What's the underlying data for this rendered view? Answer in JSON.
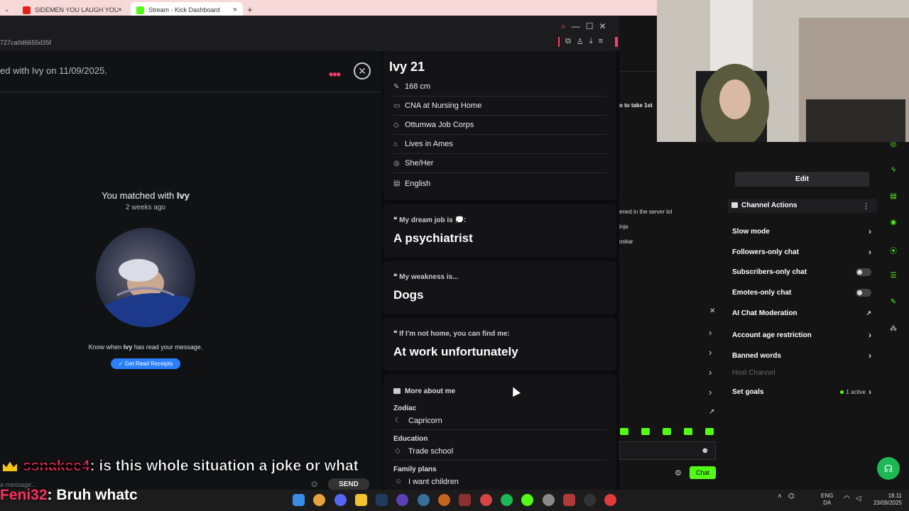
{
  "browser": {
    "tabs": [
      {
        "label": "SIDEMEN YOU LAUGH YOU LOSE",
        "favicon_color": "#e62117"
      },
      {
        "label": "Stream - Kick Dashboard",
        "favicon_color": "#53fc18"
      }
    ],
    "new_tab": "+",
    "close": "×"
  },
  "app": {
    "id_text": "727ca0d6655d35f",
    "matched_text": "ed with Ivy on 11/09/2025.",
    "more_icon": "dots-horizontal-icon",
    "close_icon": "close-circle-icon",
    "close_glyph": "✕",
    "match_title_prefix": "You matched with",
    "match_name": "Ivy",
    "match_ago": "2 weeks ago",
    "know_text_prefix": "Know when",
    "know_text_name": "Ivy",
    "know_text_suffix": "has read your message.",
    "receipts_button": "✓ Get Read Receipts",
    "message_placeholder": "a message...",
    "send_button": "SEND",
    "emoji_glyph": "☺"
  },
  "profile": {
    "name": "Ivy 21",
    "info": [
      {
        "icon": "ruler-icon",
        "glyph": "✎",
        "text": "168 cm"
      },
      {
        "icon": "briefcase-icon",
        "glyph": "▭",
        "text": "CNA at Nursing Home"
      },
      {
        "icon": "graduation-cap-icon",
        "glyph": "◇",
        "text": "Ottumwa Job Corps"
      },
      {
        "icon": "home-icon",
        "glyph": "⌂",
        "text": "Lives in Ames"
      },
      {
        "icon": "pronoun-icon",
        "glyph": "◎",
        "text": "She/Her"
      },
      {
        "icon": "language-icon",
        "glyph": "▤",
        "text": "English"
      }
    ],
    "prompts": [
      {
        "question": "My dream job is 💭:",
        "answer": "A psychiatrist"
      },
      {
        "question": "My weakness is...",
        "answer": "Dogs"
      },
      {
        "question": "If I'm not home, you can find me:",
        "answer": "At work unfortunately"
      }
    ],
    "quote_glyph": "❝",
    "more_about_title": "More about me",
    "about": [
      {
        "label": "Zodiac",
        "value": "Capricorn",
        "icon": "moon-icon",
        "glyph": "☾"
      },
      {
        "label": "Education",
        "value": "Trade school",
        "icon": "graduation-cap-icon",
        "glyph": "◇"
      },
      {
        "label": "Family plans",
        "value": "I want children",
        "icon": "baby-icon",
        "glyph": "☺"
      }
    ]
  },
  "kick": {
    "top_text": "o to take 1st",
    "chat_lines": [
      "ened in the server lol",
      "inja",
      "oskar"
    ],
    "edit_button": "Edit",
    "channel_actions_title": "Channel Actions",
    "menu_glyph": "⋮",
    "chevron_glyph": "›",
    "close_glyph": "✕",
    "external_glyph": "↗",
    "emoji_glyph": "☻",
    "gear_glyph": "⚙",
    "actions": [
      {
        "label": "Slow mode",
        "control": "chevron"
      },
      {
        "label": "Followers-only chat",
        "control": "chevron"
      },
      {
        "label": "Subscribers-only chat",
        "control": "toggle",
        "on": false
      },
      {
        "label": "Emotes-only chat",
        "control": "toggle",
        "on": false
      },
      {
        "label": "AI Chat Moderation",
        "control": "external"
      },
      {
        "label": "Account age restriction",
        "control": "chevron"
      },
      {
        "label": "Banned words",
        "control": "chevron"
      },
      {
        "label": "Host Channel",
        "control": "disabled"
      },
      {
        "label": "Set goals",
        "control": "chevron",
        "status": "1 active"
      }
    ],
    "chat_button": "Chat",
    "accent_color": "#53fc18"
  },
  "overlay": {
    "line1_user": "ssnakee4",
    "line1_text": ": is this whole situation a joke or what",
    "line2_user": "Feni32",
    "line2_text": ": Bruh whatc"
  },
  "taskbar": {
    "lang_line1": "ENG",
    "lang_line2": "DA",
    "time": "18.11",
    "date": "23/09/2025"
  }
}
